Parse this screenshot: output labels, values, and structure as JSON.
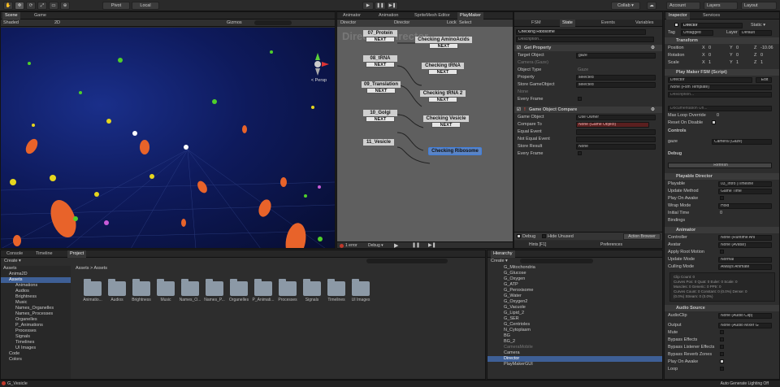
{
  "toolbar": {
    "pivot": "Pivot",
    "local": "Local",
    "collab": "Collab ▾",
    "account": "Account",
    "layers": "Layers",
    "layout": "Layout"
  },
  "scene": {
    "tab_scene": "Scene",
    "tab_game": "Game",
    "shaded": "Shaded",
    "mode_2d": "2D",
    "gizmos": "Gizmos",
    "persp": "< Persp"
  },
  "fsm": {
    "tabs": [
      "Animator",
      "Animation",
      "SpriteMesh Editor",
      "PlayMaker"
    ],
    "header_left": "Director",
    "header_mid": "Director",
    "lock": "Lock",
    "select": "Select",
    "watermark": "Directo  : Director",
    "states": [
      {
        "title": "07_Protein",
        "next": "NEXT"
      },
      {
        "title": "08_tRNA",
        "next": "NEXT"
      },
      {
        "title": "09_Translation",
        "next": "NEXT"
      },
      {
        "title": "10_Golgi",
        "next": "NEXT"
      },
      {
        "title": "11_Vesicle",
        "next": ""
      },
      {
        "title": "Checking AminoAcids",
        "next": "NEXT"
      },
      {
        "title": "Checking tRNA",
        "next": "NEXT"
      },
      {
        "title": "Checking tRNA 2",
        "next": "NEXT"
      },
      {
        "title": "Checking Vesicle",
        "next": "NEXT"
      },
      {
        "title": "Checking Ribosome",
        "next": ""
      }
    ],
    "footer_error": "1 error",
    "footer_debug": "Debug ▾",
    "hints": "Hints [F1]",
    "prefs": "Preferences"
  },
  "state_panel": {
    "tabs": [
      "FSM",
      "State",
      "Events",
      "Variables"
    ],
    "state_name": "Checking Ribosome",
    "description": "Description...",
    "action1": {
      "title": "Get Property",
      "rows": [
        [
          "Target Object",
          "gaze"
        ],
        [
          "Camera (Gaze)",
          ""
        ],
        [
          "Object Type",
          "Gaze"
        ],
        [
          "Property",
          "selected"
        ],
        [
          "Store GameObject",
          "selected"
        ],
        [
          "None",
          ""
        ],
        [
          "Every Frame",
          ""
        ]
      ]
    },
    "action2": {
      "title": "Game Object Compare",
      "rows": [
        [
          "Game Object",
          "Use Owner"
        ],
        [
          "Compare To",
          "None (Game Object)"
        ],
        [
          "Equal Event",
          ""
        ],
        [
          "Not Equal Event",
          ""
        ],
        [
          "Store Result",
          "None"
        ],
        [
          "Every Frame",
          ""
        ]
      ]
    },
    "debug": "Debug",
    "hide_unused": "Hide Unused",
    "action_browser": "Action Browser"
  },
  "project": {
    "tabs": [
      "Console",
      "Timeline",
      "Project"
    ],
    "create": "Create ▾",
    "breadcrumb": "Assets > Assets",
    "tree": [
      "Assets",
      "Anima2D",
      "Assets",
      "Animations",
      "Audios",
      "Brightness",
      "Music",
      "Names_Organelles",
      "Names_Processes",
      "Organelles",
      "P_Animations",
      "Processes",
      "Signals",
      "Timelines",
      "UI Images",
      "Code",
      "Colors"
    ],
    "folders": [
      "Animatio...",
      "Audios",
      "Brightness",
      "Music",
      "Names_O...",
      "Names_P...",
      "Organelles",
      "P_Animati...",
      "Processes",
      "Signals",
      "Timelines",
      "UI Images"
    ]
  },
  "hierarchy": {
    "tab": "Hierarchy",
    "create": "Create ▾",
    "items": [
      "G_Mitochondria",
      "G_Glucose",
      "G_Oxygen",
      "G_ATP",
      "G_Peroxisome",
      "G_Water",
      "G_Oxygen2",
      "G_Vacuole",
      "G_Lipid_2",
      "G_SER",
      "G_Centrioles",
      "N_Cytoplasm",
      "BG",
      "BG_2",
      "CameraMobile",
      "Camera",
      "Director",
      "PlayMakerGUI"
    ],
    "selected": "Director"
  },
  "inspector": {
    "tabs": [
      "Inspector",
      "Services"
    ],
    "name": "Director",
    "static": "Static ▾",
    "tag": "Untagged",
    "layer": "Default",
    "transform": {
      "title": "Transform",
      "position": [
        "0",
        "0",
        "-10.06"
      ],
      "rotation": [
        "0",
        "0",
        "0"
      ],
      "scale": [
        "1",
        "1",
        "1"
      ]
    },
    "playmaker": {
      "title": "Play Maker FSM (Script)",
      "fsm_name": "Director",
      "edit": "Edit",
      "template": "None (Fsm Template)",
      "description": "Description...",
      "doc_url": "Documentation Url...",
      "max_loop": "Max Loop Override",
      "max_loop_val": "0",
      "reset": "Reset On Disable",
      "controls": "Controls",
      "gaze": "gaze",
      "gaze_val": "Camera (Gaze)",
      "debug": "Debug",
      "refresh": "Refresh"
    },
    "director": {
      "title": "Playable Director",
      "playable": "03_Intro (Timeline",
      "update": "Game Time",
      "wrap": "Hold",
      "initial_time": "0",
      "rows": [
        "Playable",
        "Update Method",
        "Play On Awake",
        "Wrap Mode",
        "Initial Time",
        "Bindings"
      ]
    },
    "animator": {
      "title": "Animator",
      "controller": "None (Runtime Ani",
      "avatar": "None (Avatar)",
      "update": "Normal",
      "culling": "Always Animate",
      "rows": [
        "Controller",
        "Avatar",
        "Apply Root Motion",
        "Update Mode",
        "Culling Mode"
      ],
      "info": [
        "Clip Count: 0",
        "Curves Pos: 0 Quat: 0 Euler: 0 Scale: 0",
        "Muscles: 0 Generic: 0 PPtr: 0",
        "Curves Count: 0 Constant: 0 (0.0%) Dense: 0",
        "(0.0%) Stream: 0 (0.0%)"
      ]
    },
    "audio": {
      "title": "Audio Source",
      "clip": "None (Audio Clip)",
      "output": "None (Audio Mixer G",
      "rows": [
        "AudioClip",
        "Output",
        "Mute",
        "Bypass Effects",
        "Bypass Listener Effects",
        "Bypass Reverb Zones",
        "Play On Awake",
        "Loop"
      ]
    }
  },
  "status": {
    "left": "G_Vesicle",
    "right": "Auto Generate Lighting Off"
  },
  "colors": {
    "accent": "#3e5f96",
    "selected_state": "#5b84c4",
    "error": "#c0392b"
  }
}
